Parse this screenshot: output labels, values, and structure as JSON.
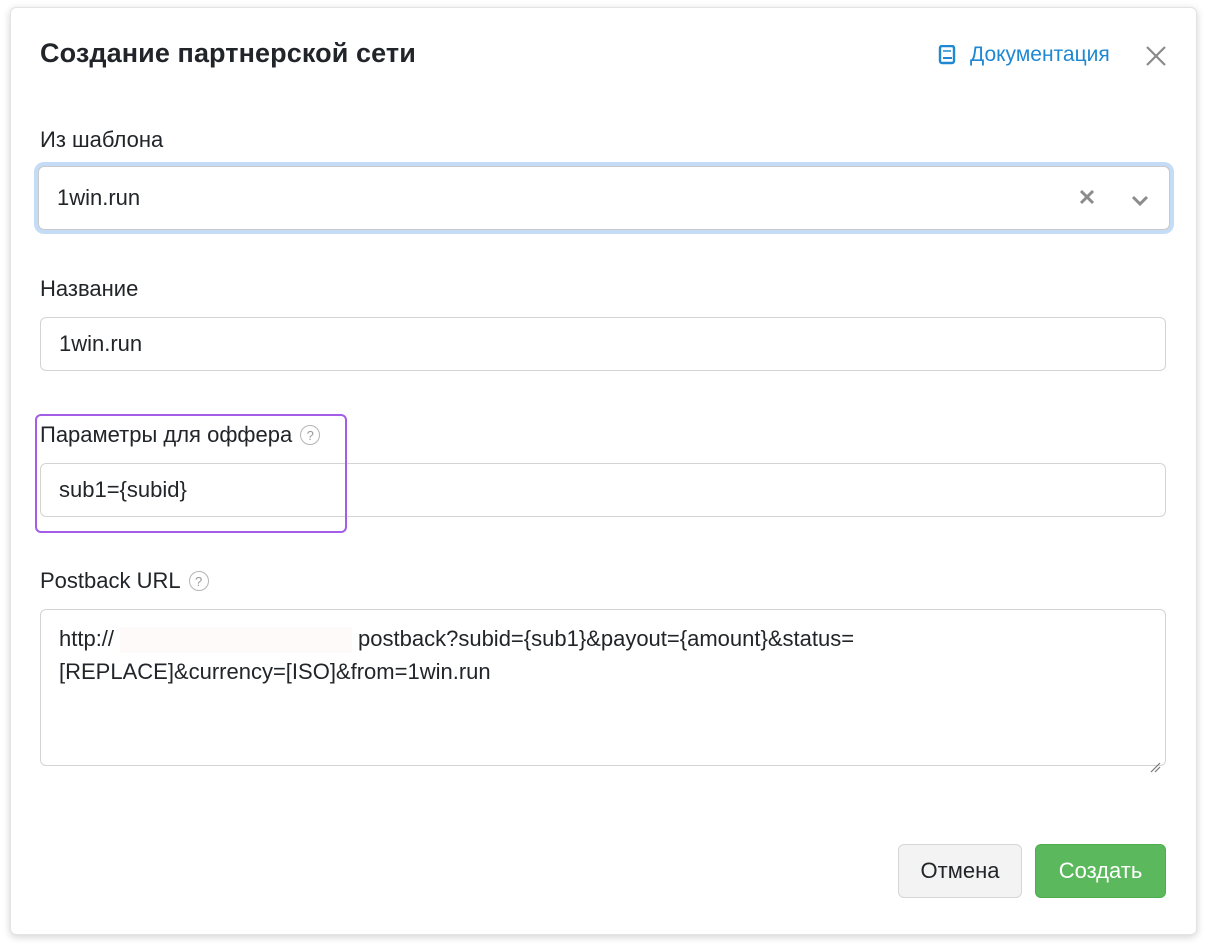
{
  "modal": {
    "title": "Создание партнерской сети",
    "doc_link": "Документация",
    "doc_icon": "book-icon",
    "close_icon": "close-icon",
    "accent_color": "#1e88d3"
  },
  "template_field": {
    "label": "Из шаблона",
    "value": "1win.run",
    "clear_icon": "clear-icon",
    "dropdown_icon": "chevron-down-icon"
  },
  "name_field": {
    "label": "Название",
    "value": "1win.run"
  },
  "offer_params_field": {
    "label": "Параметры для оффера",
    "value": "sub1={subid}",
    "help_icon": "question-circle-icon",
    "help_glyph": "?",
    "highlight_color": "#a35de6"
  },
  "postback_field": {
    "label": "Postback URL",
    "help_icon": "question-circle-icon",
    "help_glyph": "?",
    "value_prefix": "http://",
    "value_suffix": "postback?subid={sub1}&payout={amount}&status=",
    "value_line2": "[REPLACE]&currency=[ISO]&from=1win.run"
  },
  "footer": {
    "cancel_label": "Отмена",
    "create_label": "Создать",
    "create_color": "#5cb85c"
  }
}
